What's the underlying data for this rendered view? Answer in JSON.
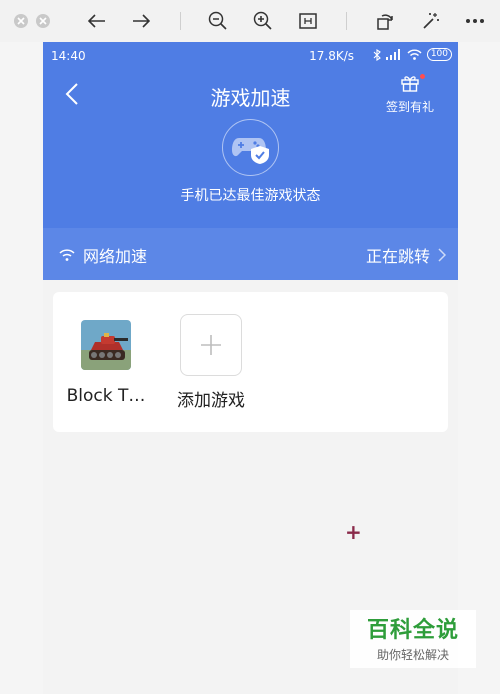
{
  "viewer": {
    "tools": [
      "close-icon",
      "minimize-icon",
      "back-arrow-icon",
      "forward-arrow-icon",
      "zoom-out-icon",
      "zoom-in-icon",
      "fit-page-icon",
      "rotate-icon",
      "magic-wand-icon",
      "more-icon"
    ]
  },
  "status_bar": {
    "time": "14:40",
    "speed": "17.8K/s",
    "battery": "100"
  },
  "header": {
    "title": "游戏加速",
    "checkin_label": "签到有礼",
    "status_text": "手机已达最佳游戏状态"
  },
  "network": {
    "label": "网络加速",
    "status": "正在跳转"
  },
  "games": [
    {
      "label": "Block T…"
    },
    {
      "label": "添加游戏"
    }
  ],
  "watermark": {
    "title": "百科全说",
    "subtitle": "助你轻松解决"
  },
  "colors": {
    "header_blue": "#4f7de4",
    "net_row_blue": "#5c87e7",
    "watermark_green": "#2e9d3a"
  }
}
